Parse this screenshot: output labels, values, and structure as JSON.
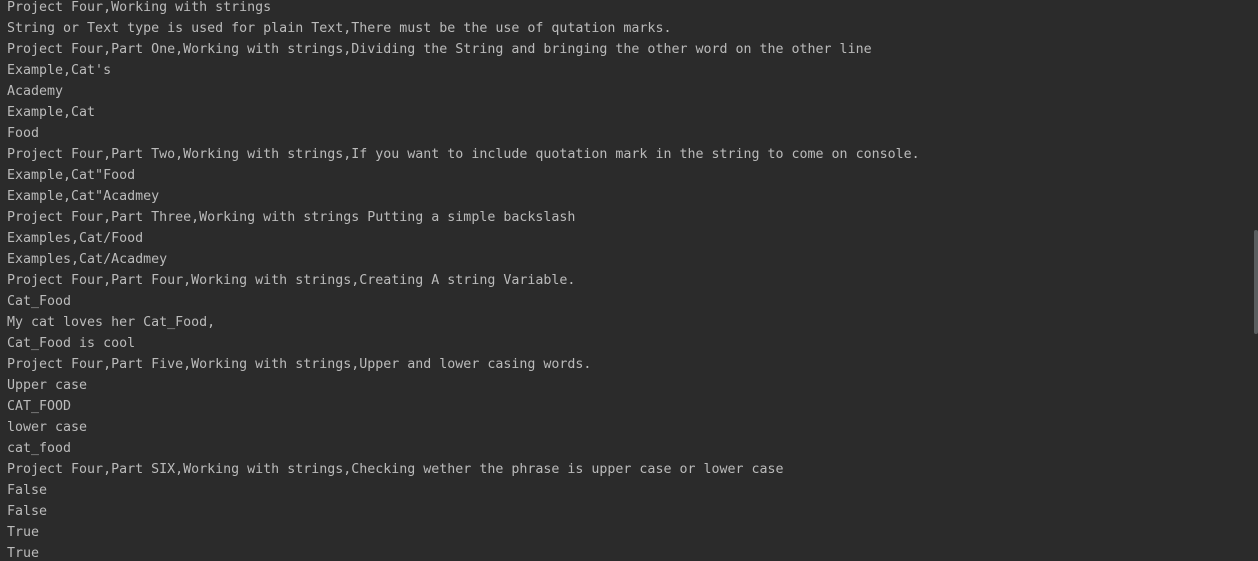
{
  "console": {
    "lines": [
      "Project Four,Working with strings",
      "String or Text type is used for plain Text,There must be the use of qutation marks.",
      "Project Four,Part One,Working with strings,Dividing the String and bringing the other word on the other line",
      "Example,Cat's",
      "Academy",
      "Example,Cat",
      "Food",
      "Project Four,Part Two,Working with strings,If you want to include quotation mark in the string to come on console.",
      "Example,Cat\"Food",
      "Example,Cat\"Acadmey",
      "Project Four,Part Three,Working with strings Putting a simple backslash",
      "Examples,Cat/Food",
      "Examples,Cat/Acadmey",
      "Project Four,Part Four,Working with strings,Creating A string Variable.",
      "Cat_Food",
      "My cat loves her Cat_Food,",
      "Cat_Food is cool",
      "Project Four,Part Five,Working with strings,Upper and lower casing words.",
      "Upper case",
      "CAT_FOOD",
      "lower case",
      "cat_food",
      "Project Four,Part SIX,Working with strings,Checking wether the phrase is upper case or lower case",
      "False",
      "False",
      "True",
      "True"
    ]
  },
  "colors": {
    "background": "#2b2b2b",
    "text": "#bbbbbb",
    "scrollbar": "#5a5d5f"
  }
}
